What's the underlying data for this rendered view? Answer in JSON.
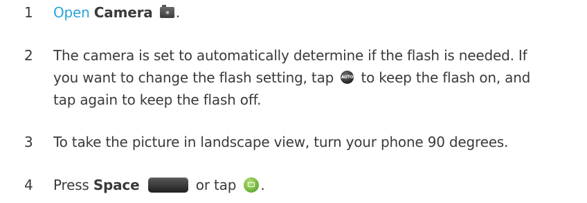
{
  "steps": [
    {
      "number": "1",
      "open_link": "Open",
      "app_name": "Camera",
      "icon": "camera-icon",
      "end": "."
    },
    {
      "number": "2",
      "line1": "The camera is set to automatically determine if the flash is needed. If",
      "line2_before": "you want to change the flash setting, tap",
      "icon": "auto-flash-icon",
      "icon_text": "AUTO",
      "line2_after": "to keep the flash on, and",
      "line3": "tap again to keep the flash off."
    },
    {
      "number": "3",
      "text": "To take the picture in landscape view, turn your phone 90 degrees."
    },
    {
      "number": "4",
      "before": "Press",
      "key_name": "Space",
      "key_icon": "space-key-icon",
      "middle": "or tap",
      "tap_icon": "camera-shutter-icon",
      "end": "."
    }
  ]
}
